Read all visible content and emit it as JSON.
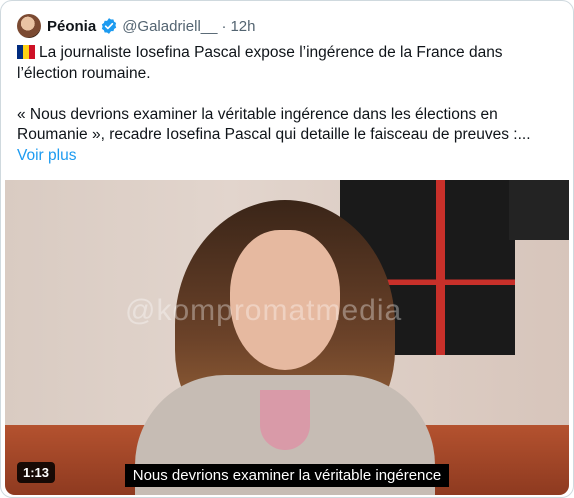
{
  "tweet": {
    "author_name": "Péonia",
    "author_handle": "@Galadriell__",
    "separator": "·",
    "time": "12h",
    "flag_colors": [
      "#002b7f",
      "#fcd116",
      "#ce1126"
    ],
    "paragraph1": "La journaliste Iosefina Pascal expose l’ingérence de la France dans l’élection roumaine.",
    "paragraph2": "« Nous devrions examiner la véritable ingérence dans les élections en Roumanie », recadre Iosefina Pascal qui detaille le faisceau de preuves :...",
    "see_more": "Voir plus"
  },
  "video": {
    "duration": "1:13",
    "subtitle": "Nous devrions examiner la véritable ingérence",
    "watermark": "@kompromatmedia"
  },
  "colors": {
    "link": "#1d9bf0",
    "verified": "#1d9bf0",
    "secondary_text": "#536471"
  }
}
